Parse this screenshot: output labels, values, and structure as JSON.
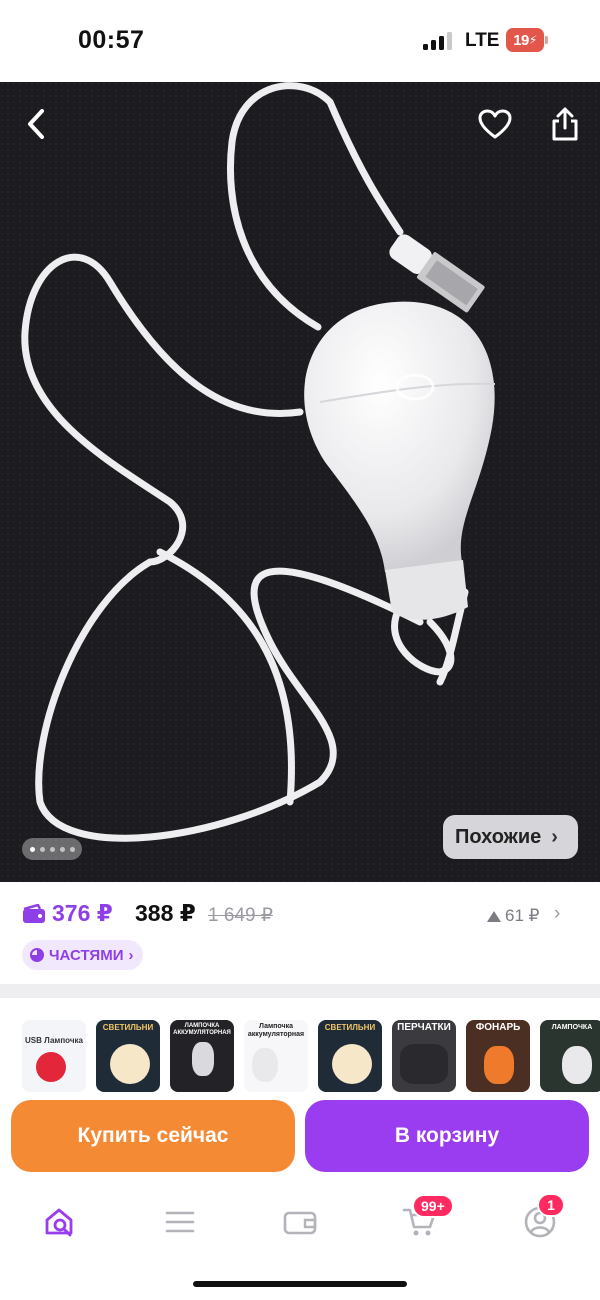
{
  "status_bar": {
    "time": "00:57",
    "network": "LTE",
    "battery": "19"
  },
  "gallery": {
    "similar_label": "Похожие",
    "icons": {
      "back": "back-chevron-icon",
      "favorite": "heart-icon",
      "share": "share-icon"
    },
    "total_images": 5,
    "active_image": 1
  },
  "price": {
    "card_price": "376 ₽",
    "regular_price": "388 ₽",
    "old_price": "1 649 ₽",
    "change": "61 ₽",
    "installments_label": "ЧАСТЯМИ",
    "card_price_color": "#8f3fe8"
  },
  "thumbnails": [
    {
      "label": "USB Лампочка"
    },
    {
      "label": "СВЕТИЛЬНИ"
    },
    {
      "label": "ЛАМПОЧКА АККУМУЛЯТОРНАЯ"
    },
    {
      "label": "Лампочка аккумуляторная"
    },
    {
      "label": "СВЕТИЛЬНИ"
    },
    {
      "label": "ПЕРЧАТКИ"
    },
    {
      "label": "ФОНАРЬ"
    },
    {
      "label": "ЛАМПОЧКА"
    }
  ],
  "actions": {
    "buy_now": "Купить сейчас",
    "add_to_cart": "В корзину",
    "buy_color": "#f58a35",
    "cart_color": "#9a3cf0"
  },
  "tab_bar": {
    "items": [
      {
        "name": "home-search",
        "icon": "home-search-icon",
        "active": true
      },
      {
        "name": "catalog",
        "icon": "menu-icon"
      },
      {
        "name": "wallet",
        "icon": "wallet-icon"
      },
      {
        "name": "cart",
        "icon": "cart-icon",
        "badge": "99+"
      },
      {
        "name": "profile",
        "icon": "profile-icon",
        "badge": "1"
      }
    ]
  }
}
